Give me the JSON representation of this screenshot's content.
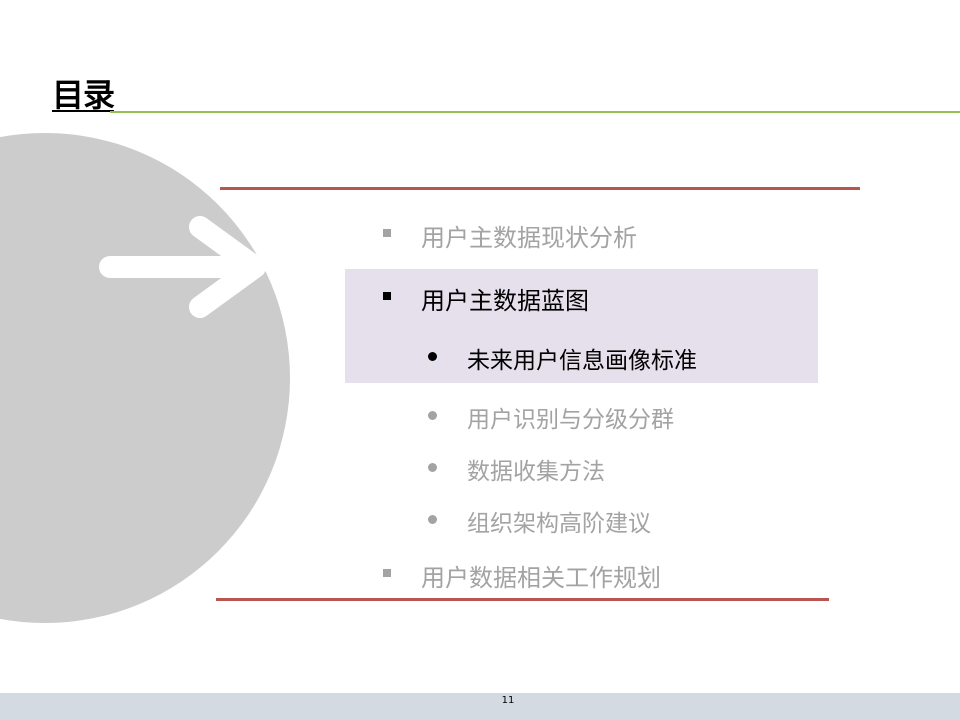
{
  "slide": {
    "title": "目录",
    "page_number": "11"
  },
  "colors": {
    "title_rule": "#92c353",
    "section_rule": "#b95551",
    "highlight": "#e6e0ec",
    "circle": "#cccccc",
    "inactive_text": "#a3a3a3",
    "active_text": "#000000",
    "footer_band": "#d4dae2"
  },
  "icons": {
    "arrow": "right-arrow-icon"
  },
  "toc": {
    "items": [
      {
        "label": "用户主数据现状分析",
        "level": 1,
        "active": false
      },
      {
        "label": "用户主数据蓝图",
        "level": 1,
        "active": true
      },
      {
        "label": "未来用户信息画像标准",
        "level": 2,
        "active": true
      },
      {
        "label": "用户识别与分级分群",
        "level": 2,
        "active": false
      },
      {
        "label": "数据收集方法",
        "level": 2,
        "active": false
      },
      {
        "label": "组织架构高阶建议",
        "level": 2,
        "active": false
      },
      {
        "label": "用户数据相关工作规划",
        "level": 1,
        "active": false
      }
    ]
  }
}
